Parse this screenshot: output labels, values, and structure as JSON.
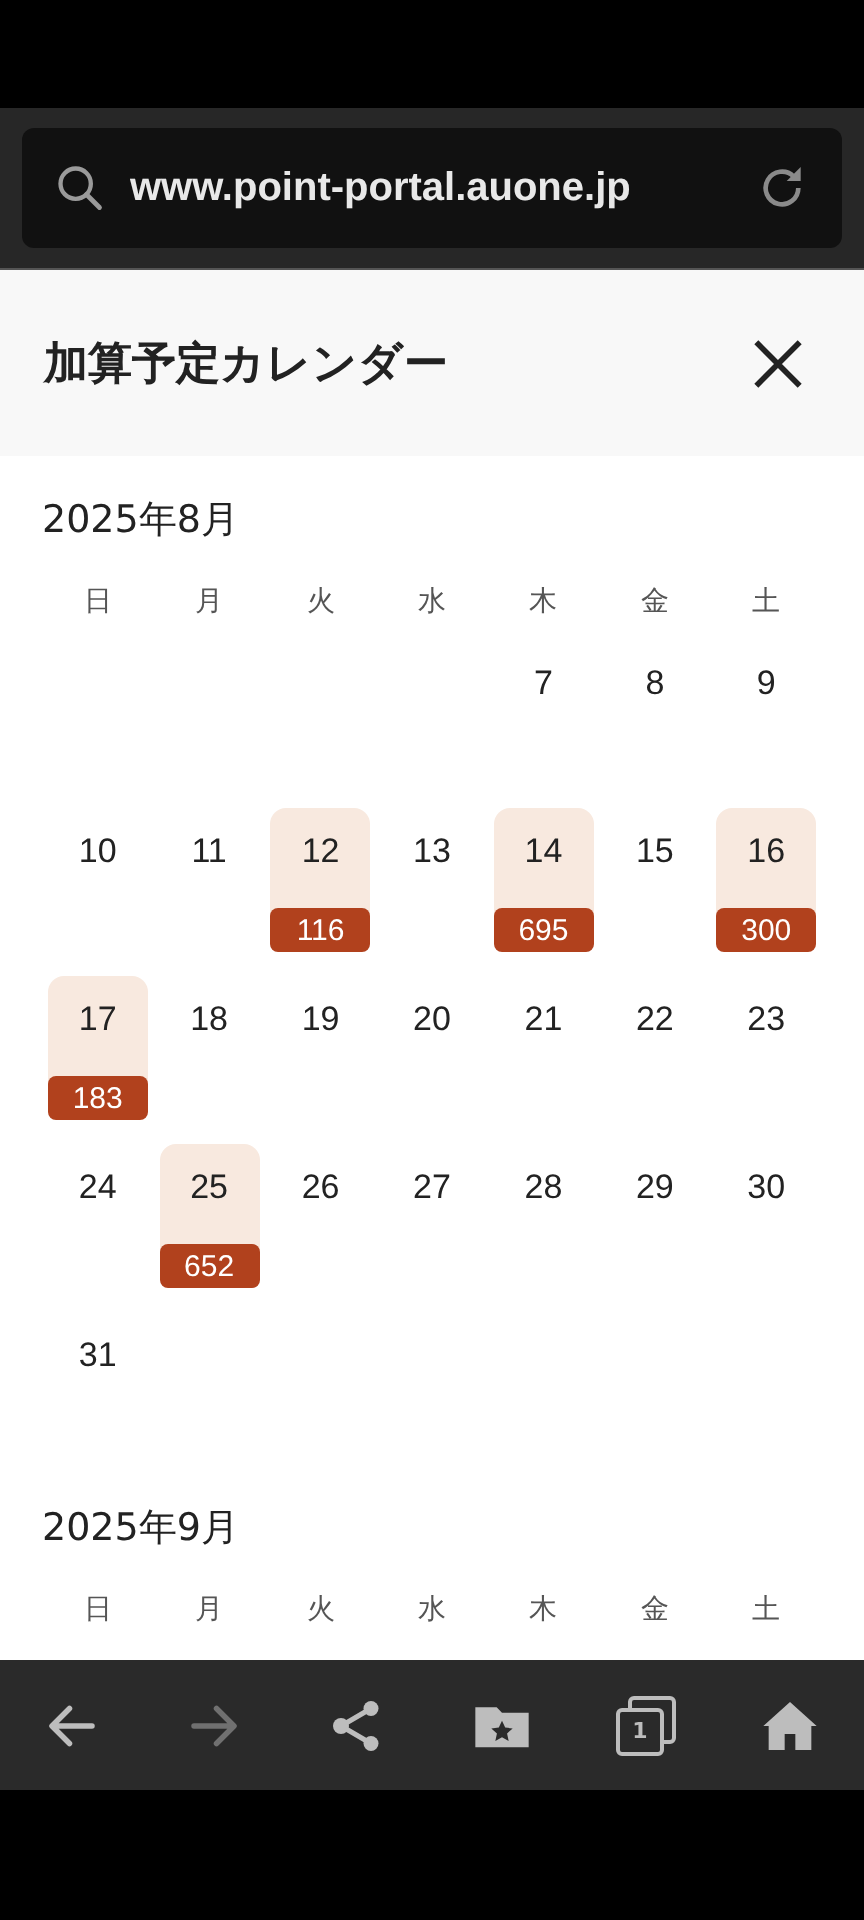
{
  "address_bar": {
    "url": "www.point-portal.auone.jp"
  },
  "header": {
    "title": "加算予定カレンダー"
  },
  "months": [
    {
      "title": "2025年8月",
      "weekdays": [
        "日",
        "月",
        "火",
        "水",
        "木",
        "金",
        "土"
      ],
      "weeks": [
        [
          {
            "kind": "blank"
          },
          {
            "kind": "blank"
          },
          {
            "kind": "blank"
          },
          {
            "kind": "blank"
          },
          {
            "kind": "day",
            "day": "7"
          },
          {
            "kind": "day",
            "day": "8"
          },
          {
            "kind": "day",
            "day": "9"
          }
        ],
        [
          {
            "kind": "day",
            "day": "10"
          },
          {
            "kind": "day",
            "day": "11"
          },
          {
            "kind": "day",
            "day": "12",
            "points": "116"
          },
          {
            "kind": "day",
            "day": "13"
          },
          {
            "kind": "day",
            "day": "14",
            "points": "695"
          },
          {
            "kind": "day",
            "day": "15"
          },
          {
            "kind": "day",
            "day": "16",
            "points": "300"
          }
        ],
        [
          {
            "kind": "day",
            "day": "17",
            "points": "183"
          },
          {
            "kind": "day",
            "day": "18"
          },
          {
            "kind": "day",
            "day": "19"
          },
          {
            "kind": "day",
            "day": "20"
          },
          {
            "kind": "day",
            "day": "21"
          },
          {
            "kind": "day",
            "day": "22"
          },
          {
            "kind": "day",
            "day": "23"
          }
        ],
        [
          {
            "kind": "day",
            "day": "24"
          },
          {
            "kind": "day",
            "day": "25",
            "points": "652"
          },
          {
            "kind": "day",
            "day": "26"
          },
          {
            "kind": "day",
            "day": "27"
          },
          {
            "kind": "day",
            "day": "28"
          },
          {
            "kind": "day",
            "day": "29"
          },
          {
            "kind": "day",
            "day": "30"
          }
        ],
        [
          {
            "kind": "day",
            "day": "31"
          }
        ]
      ]
    },
    {
      "title": "2025年9月",
      "weekdays": [
        "日",
        "月",
        "火",
        "水",
        "木",
        "金",
        "土"
      ]
    }
  ],
  "bottom_bar": {
    "back_disabled": false,
    "forward_disabled": true,
    "tab_count": "1"
  }
}
